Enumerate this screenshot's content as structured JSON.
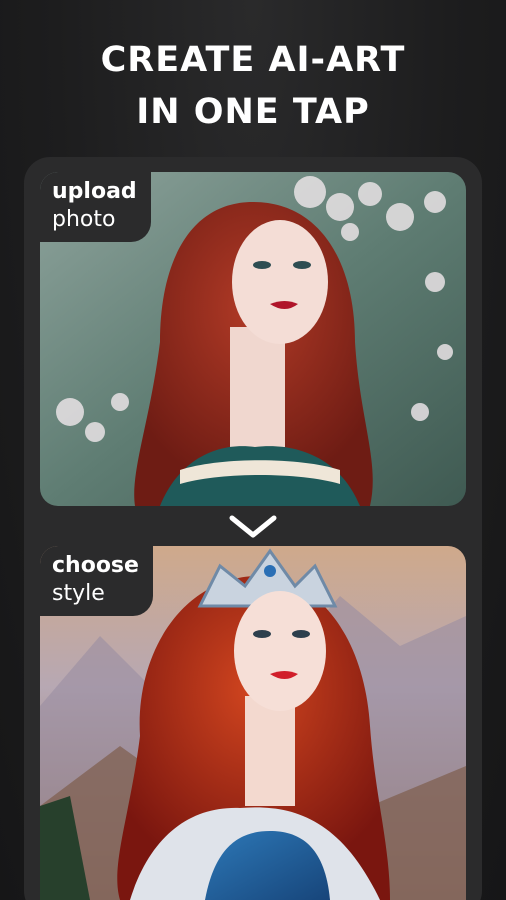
{
  "headline": {
    "line1": "CREATE AI-ART",
    "line2": "IN ONE TAP"
  },
  "steps": [
    {
      "title": "upload",
      "subtitle": "photo"
    },
    {
      "title": "choose",
      "subtitle": "style"
    }
  ],
  "icons": {
    "next_step": "chevron-down-icon"
  },
  "colors": {
    "background": "#1b1b1c",
    "frame": "#2b2b2c",
    "text": "#ffffff",
    "hair": "#9b2a1e",
    "dress": "#1f5a5a"
  }
}
